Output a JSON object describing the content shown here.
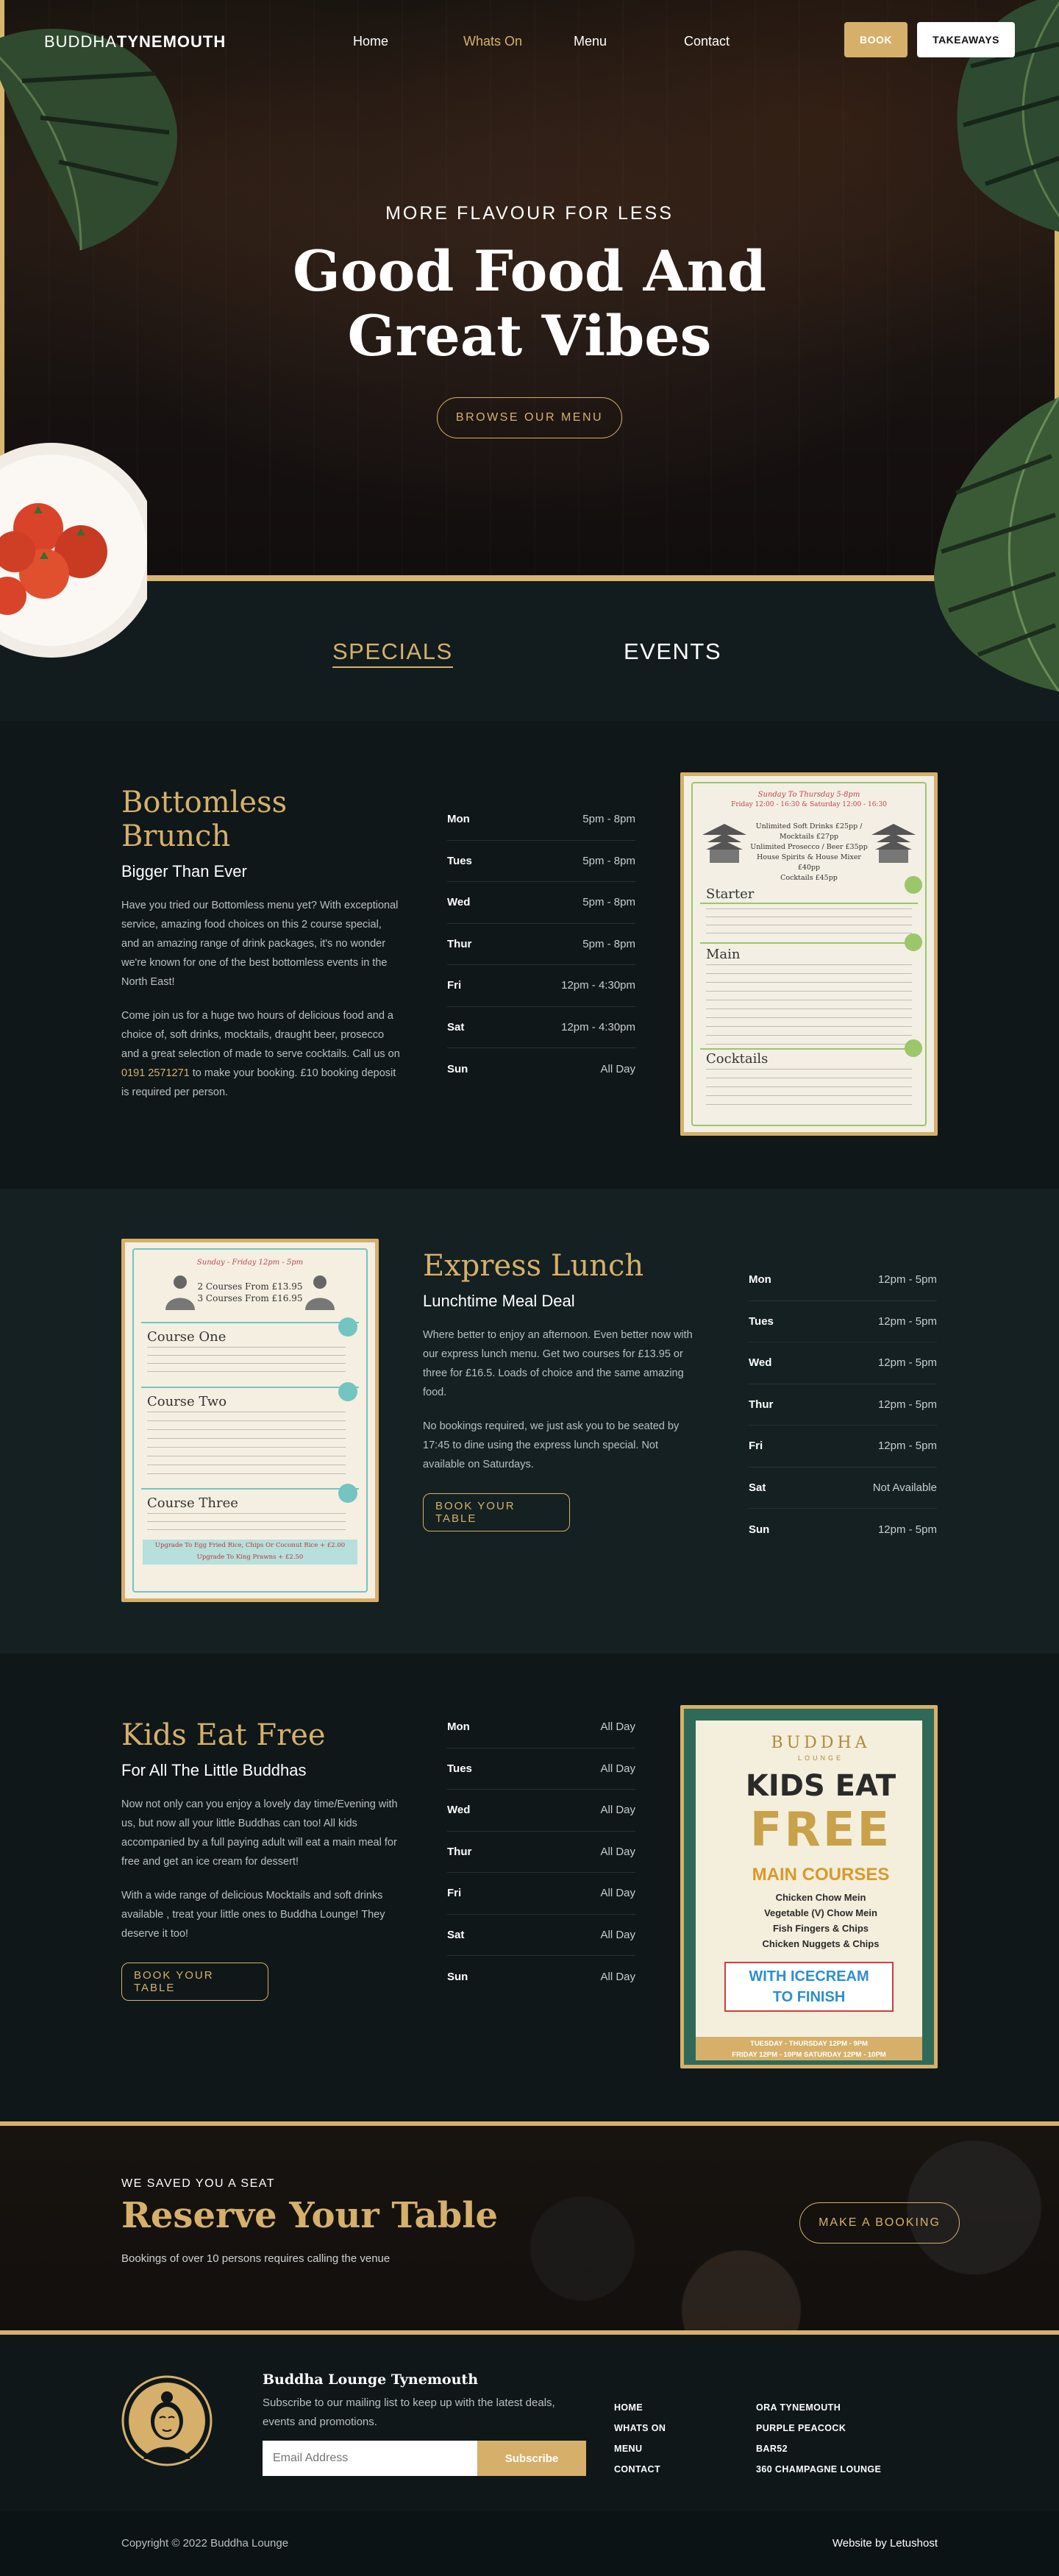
{
  "brand": {
    "logo_light": "BUDDHA",
    "logo_bold": "TYNEMOUTH",
    "gold": "#d6b06a",
    "bg": "#0f1719"
  },
  "nav": {
    "items": [
      "Home",
      "Whats On",
      "Menu",
      "Contact"
    ],
    "active": "Whats On",
    "book_label": "BOOK",
    "takeaways_label": "TAKEAWAYS"
  },
  "hero": {
    "eyebrow": "MORE FLAVOUR FOR LESS",
    "title_line1": "Good Food And",
    "title_line2": "Great Vibes",
    "cta": "BROWSE OUR MENU"
  },
  "tabs": {
    "specials": "SPECIALS",
    "events": "EVENTS",
    "active": "SPECIALS"
  },
  "specials": [
    {
      "title": "Bottomless Brunch",
      "subtitle": "Bigger Than Ever",
      "p1": "Have you tried our Bottomless menu yet? With exceptional service, amazing food choices on this 2 course special, and an amazing range of drink packages, it's no wonder we're known for one of the best bottomless events in the North East!",
      "p2_before": "Come join us for a huge two hours of delicious food and a choice of, soft drinks, mocktails, draught beer, prosecco and a great selection of made to serve cocktails. Call us on ",
      "p2_phone": "0191 2571271",
      "p2_after": " to make your booking. £10 booking deposit is required per person.",
      "hours": [
        {
          "day": "Mon",
          "time": "5pm - 8pm"
        },
        {
          "day": "Tues",
          "time": "5pm - 8pm"
        },
        {
          "day": "Wed",
          "time": "5pm - 8pm"
        },
        {
          "day": "Thur",
          "time": "5pm - 8pm"
        },
        {
          "day": "Fri",
          "time": "12pm - 4:30pm"
        },
        {
          "day": "Sat",
          "time": "12pm - 4:30pm"
        },
        {
          "day": "Sun",
          "time": "All Day"
        }
      ],
      "poster": {
        "head1": "Sunday To Thursday 5-8pm",
        "head2": "Friday 12:00 - 16:30 & Saturday 12:00 - 16:30",
        "l1": "Unlimited Soft Drinks £25pp / Mocktails £27pp",
        "l2": "Unlimited Prosecco / Beer £35pp",
        "l3": "House Spirits & House Mixer £40pp",
        "l4": "Cocktails £45pp",
        "starter": "Starter",
        "main": "Main",
        "cocktails": "Cocktails"
      }
    },
    {
      "title": "Express Lunch",
      "subtitle": "Lunchtime Meal Deal",
      "p1": "Where better to enjoy an afternoon. Even better now with our express lunch menu. Get two courses for £13.95 or three for £16.5. Loads of choice and the same amazing food.",
      "p2": "No bookings required, we just ask you to be seated by 17:45 to dine using the express lunch special. Not available on Saturdays.",
      "button": "BOOK YOUR TABLE",
      "hours": [
        {
          "day": "Mon",
          "time": "12pm - 5pm"
        },
        {
          "day": "Tues",
          "time": "12pm - 5pm"
        },
        {
          "day": "Wed",
          "time": "12pm - 5pm"
        },
        {
          "day": "Thur",
          "time": "12pm - 5pm"
        },
        {
          "day": "Fri",
          "time": "12pm - 5pm"
        },
        {
          "day": "Sat",
          "time": "Not Available"
        },
        {
          "day": "Sun",
          "time": "12pm - 5pm"
        }
      ],
      "poster": {
        "head": "Sunday - Friday 12pm - 5pm",
        "l1": "2 Courses From £13.95",
        "l2": "3 Courses From £16.95",
        "c1": "Course One",
        "c2": "Course Two",
        "c3": "Course Three",
        "upgrade": "Upgrade To Egg Fried Rice, Chips Or Coconut Rice + £2.00",
        "upgrade2": "Upgrade To King Prawns + £2.50"
      }
    },
    {
      "title": "Kids Eat Free",
      "subtitle": "For All The Little Buddhas",
      "p1": "Now not only can you enjoy a lovely day time/Evening with us, but now all your little Buddhas can too! All kids accompanied by a full paying adult will eat a main meal for free and get an ice cream for dessert!",
      "p2": "With a wide range of delicious Mocktails and soft drinks available , treat your little ones to Buddha Lounge! They deserve it too!",
      "button": "BOOK YOUR TABLE",
      "hours": [
        {
          "day": "Mon",
          "time": "All Day"
        },
        {
          "day": "Tues",
          "time": "All Day"
        },
        {
          "day": "Wed",
          "time": "All Day"
        },
        {
          "day": "Thur",
          "time": "All Day"
        },
        {
          "day": "Fri",
          "time": "All Day"
        },
        {
          "day": "Sat",
          "time": "All Day"
        },
        {
          "day": "Sun",
          "time": "All Day"
        }
      ],
      "poster": {
        "brand": "BUDDHA",
        "brand_sub": "LOUNGE",
        "kids": "KIDS EAT",
        "free": "FREE",
        "main": "MAIN COURSES",
        "items": [
          "Chicken Chow Mein",
          "Vegetable (V) Chow Mein",
          "Fish Fingers & Chips",
          "Chicken Nuggets & Chips"
        ],
        "ice1": "WITH ICECREAM",
        "ice2": "TO FINISH",
        "days1": "TUESDAY - THURSDAY 12PM - 9PM",
        "days2": "FRIDAY 12PM - 10PM   SATURDAY 12PM - 10PM"
      }
    }
  ],
  "reserve": {
    "eyebrow": "WE SAVED YOU A SEAT",
    "title": "Reserve Your Table",
    "note": "Bookings of over 10 persons requires calling the venue",
    "button": "MAKE A BOOKING"
  },
  "footer": {
    "name": "Buddha Lounge Tynemouth",
    "desc": "Subscribe to our mailing list to keep up with the latest deals, events and promotions.",
    "email_placeholder": "Email Address",
    "subscribe": "Subscribe",
    "links1": [
      "HOME",
      "WHATS ON",
      "MENU",
      "CONTACT"
    ],
    "links2": [
      "ORA TYNEMOUTH",
      "PURPLE PEACOCK",
      "BAR52",
      "360 CHAMPAGNE LOUNGE"
    ],
    "copyright": "Copyright © 2022 Buddha Lounge",
    "credit": "Website by Letushost"
  }
}
